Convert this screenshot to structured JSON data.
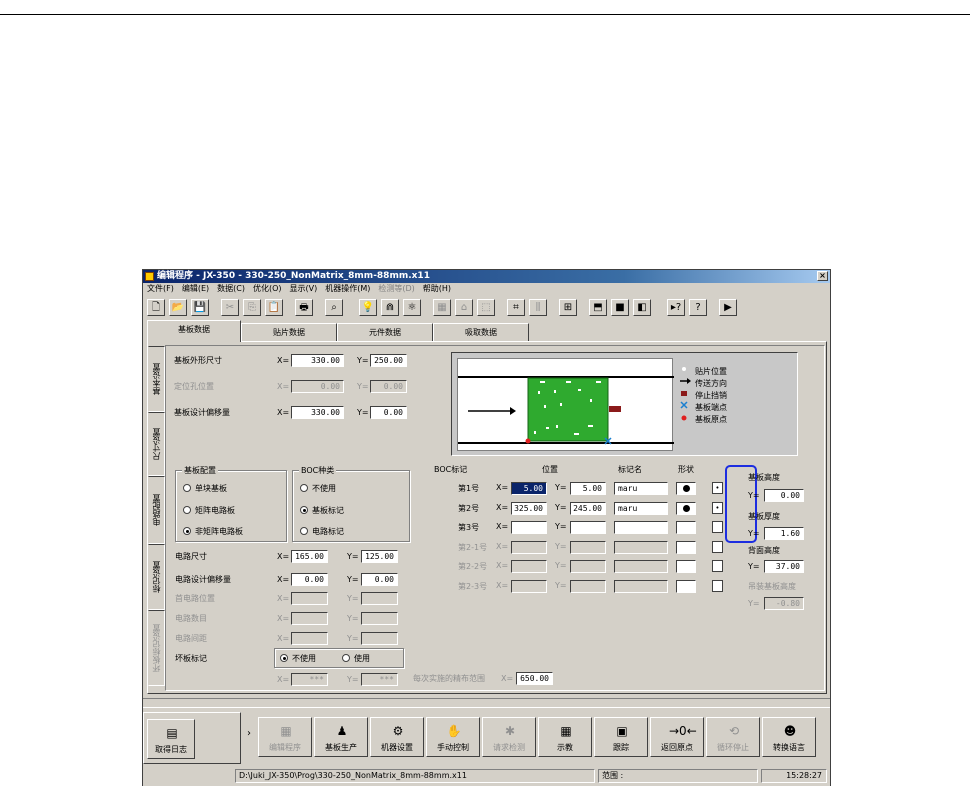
{
  "window": {
    "title": "编辑程序 - JX-350 - 330-250_NonMatrix_8mm-88mm.x11",
    "close_glyph": "×"
  },
  "menu": [
    "文件(F)",
    "编辑(E)",
    "数据(C)",
    "优化(O)",
    "显示(V)",
    "机器操作(M)",
    "检测等(D)",
    "帮助(H)"
  ],
  "menu_disabled": [
    6
  ],
  "main_tabs": [
    "基板数据",
    "贴片数据",
    "元件数据",
    "吸取数据"
  ],
  "side_tabs": [
    "基本设置",
    "尺寸设置",
    "电路配置",
    "标记设置",
    "坏板标记设置"
  ],
  "board": {
    "outer_size_label": "基板外形尺寸",
    "outer_x": "330.00",
    "outer_y": "250.00",
    "loc_hole_label": "定位孔位置",
    "loc_x": "0.00",
    "loc_y": "0.00",
    "offset_label": "基板设计偏移量",
    "offset_x": "330.00",
    "offset_y": "0.00",
    "x_prefix": "X=",
    "y_prefix": "Y="
  },
  "legend": {
    "mount_pos": "贴片位置",
    "transfer_dir": "传送方向",
    "stopper": "停止挡销",
    "board_end": "基板端点",
    "board_origin": "基板原点"
  },
  "board_config": {
    "title": "基板配置",
    "options": [
      "单块基板",
      "矩阵电路板",
      "非矩阵电路板"
    ],
    "selected": 2
  },
  "boc_type": {
    "title": "BOC种类",
    "options": [
      "不使用",
      "基板标记",
      "电路标记"
    ],
    "selected": 1
  },
  "boc_mark": {
    "title": "BOC标记",
    "pos_header": "位置",
    "name_header": "标记名",
    "shape_header": "形状",
    "rows": [
      {
        "label": "第1号",
        "x": "5.00",
        "y": "5.00",
        "name": "maru",
        "shape": "●",
        "enabled": true
      },
      {
        "label": "第2号",
        "x": "325.00",
        "y": "245.00",
        "name": "maru",
        "shape": "●",
        "enabled": true
      },
      {
        "label": "第3号",
        "x": "",
        "y": "",
        "name": "",
        "shape": "",
        "enabled": true
      },
      {
        "label": "第2-1号",
        "x": "",
        "y": "",
        "name": "",
        "shape": "",
        "enabled": false
      },
      {
        "label": "第2-2号",
        "x": "",
        "y": "",
        "name": "",
        "shape": "",
        "enabled": false
      },
      {
        "label": "第2-3号",
        "x": "",
        "y": "",
        "name": "",
        "shape": "",
        "enabled": false
      }
    ]
  },
  "heights": {
    "board_height_label": "基板高度",
    "board_height": "0.00",
    "board_thick_label": "基板厚度",
    "board_thick": "1.60",
    "back_height_label": "背面高度",
    "back_height": "37.00",
    "warp_label": "吊装基板高度",
    "warp": "-0.80",
    "z_prefix": "Y="
  },
  "circuit": {
    "size_label": "电路尺寸",
    "size_x": "165.00",
    "size_y": "125.00",
    "offset_label": "电路设计偏移量",
    "offset_x": "0.00",
    "offset_y": "0.00",
    "first_pos_label": "首电路位置",
    "count_label": "电路数目",
    "pitch_label": "电路间距",
    "bad_mark_label": "坏板标记",
    "bad_opt_no": "不使用",
    "bad_opt_yes": "使用",
    "bad_x": "***",
    "bad_y": "***",
    "range_label": "每次实施的精布范围",
    "range_prefix": "X=",
    "range_val": "650.00"
  },
  "bottom_buttons": [
    {
      "label": "取得日志",
      "icon": "▤",
      "enabled": true
    },
    {
      "label": "编辑程序",
      "icon": "▦",
      "enabled": false
    },
    {
      "label": "基板生产",
      "icon": "♟",
      "enabled": true
    },
    {
      "label": "机器设置",
      "icon": "⚙",
      "enabled": true
    },
    {
      "label": "手动控制",
      "icon": "✋",
      "enabled": true
    },
    {
      "label": "请求检测",
      "icon": "✱",
      "enabled": false
    },
    {
      "label": "示教",
      "icon": "▦",
      "enabled": true
    },
    {
      "label": "跟踪",
      "icon": "▣",
      "enabled": true
    },
    {
      "label": "返回原点",
      "icon": "→0←",
      "enabled": true
    },
    {
      "label": "循环停止",
      "icon": "⟲",
      "enabled": false
    },
    {
      "label": "转换语言",
      "icon": "☻",
      "enabled": true
    }
  ],
  "status": {
    "path": "D:\\Juki_JX-350\\Prog\\330-250_NonMatrix_8mm-88mm.x11",
    "range": "范围 :",
    "time": "15:28:27"
  },
  "toolbar_icons": [
    "new-icon",
    "open-icon",
    "save-icon",
    "cut-icon",
    "copy-icon",
    "paste-icon",
    "print-icon",
    "find-icon",
    "bulb-icon",
    "magnet-icon",
    "optimize-icon",
    "grid-icon",
    "house-icon",
    "cube-icon",
    "teach-icon",
    "align-icon",
    "calc-icon",
    "gauge-icon",
    "stop-icon",
    "box-icon",
    "help-pointer-icon",
    "help-icon",
    "run-icon"
  ]
}
